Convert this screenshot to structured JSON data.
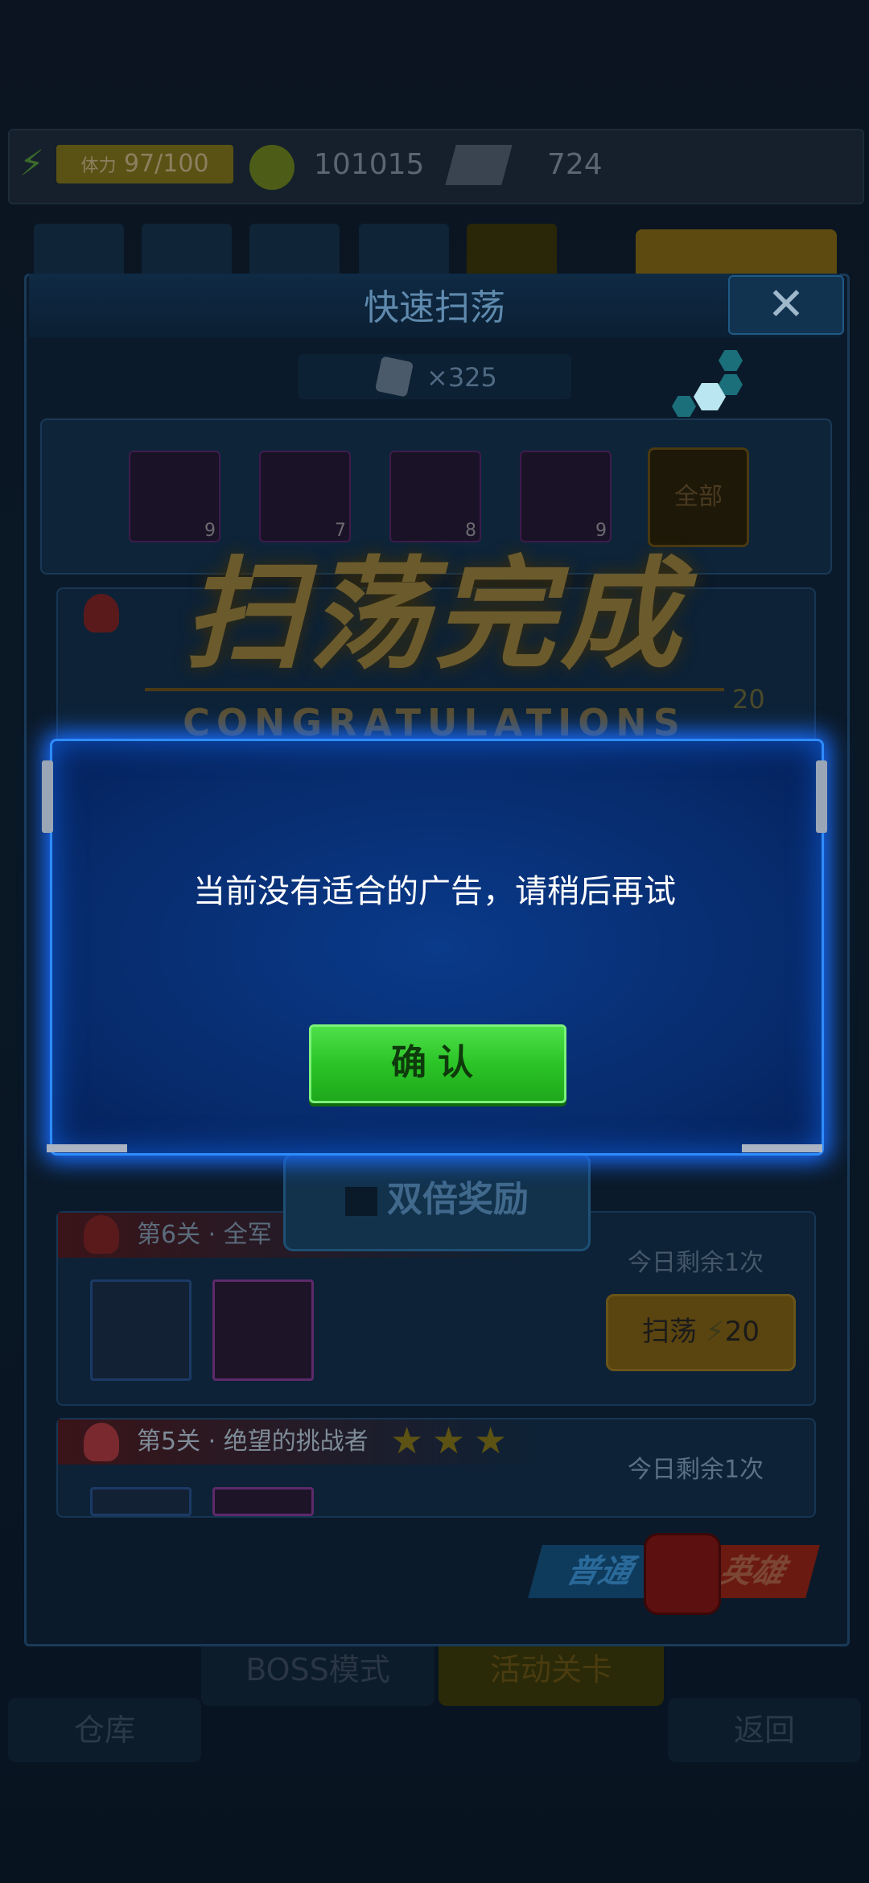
{
  "top_bar": {
    "energy_label": "体力",
    "energy_value": "97/100",
    "coins": "101015",
    "gems": "724"
  },
  "sweep_panel": {
    "title": "快速扫荡",
    "close_symbol": "✕",
    "ticket_cost": "×325",
    "filter_counts": [
      "9",
      "7",
      "8",
      "9"
    ],
    "filter_all_label": "全部",
    "banner_title": "扫荡完成",
    "banner_subtitle": "CONGRATULATIONS",
    "sweep_cost_partial": "20",
    "double_reward_label": "双倍奖励",
    "stages": [
      {
        "name": "第6关 · 全军",
        "remaining": "今日剩余1次",
        "sweep_label": "扫荡",
        "sweep_cost": "20"
      },
      {
        "name": "第5关 · 绝望的挑战者",
        "remaining": "今日剩余1次",
        "stars": 3
      }
    ],
    "mode_normal": "普通",
    "mode_hero": "英雄"
  },
  "bottom_nav": {
    "boss_mode": "BOSS模式",
    "event_stage": "活动关卡",
    "warehouse": "仓库",
    "back": "返回"
  },
  "dialog": {
    "message": "当前没有适合的广告，请稍后再试",
    "confirm_label": "确认"
  },
  "colors": {
    "dialog_bg": "#072a6a",
    "dialog_border": "#2e8cff",
    "confirm_green": "#2bc427"
  }
}
